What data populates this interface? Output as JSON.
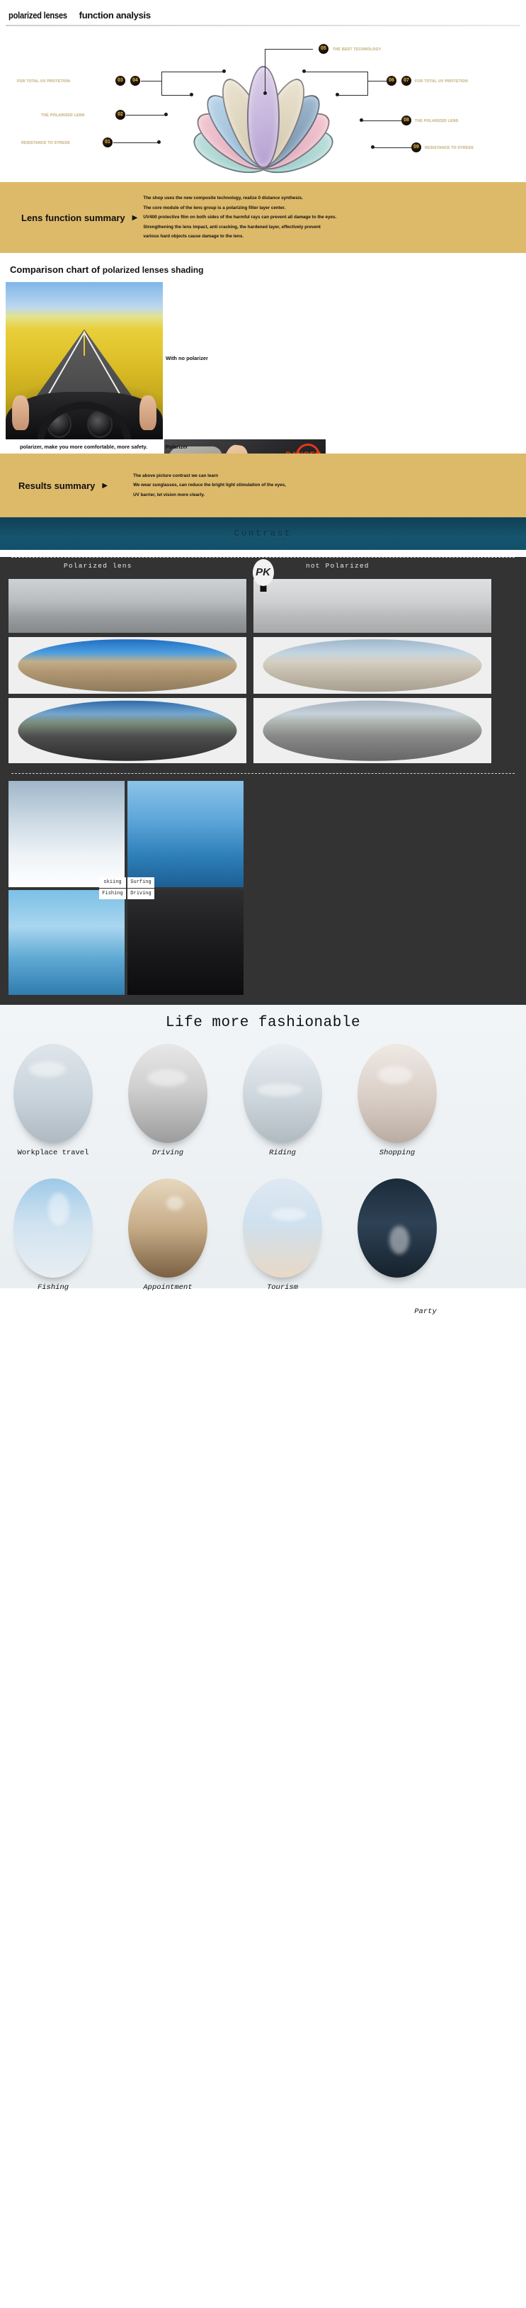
{
  "header": {
    "title_part1": "polarized lenses",
    "title_part2": "function analysis"
  },
  "lotus_diagram": {
    "labels_left": [
      {
        "num": "03",
        "num2": "04",
        "text": "FOR TOTAL UV PROTETION"
      },
      {
        "num": "02",
        "text": "THE POLARIZED LENS"
      },
      {
        "num": "01",
        "text": "RESISTANCE TO STRESS"
      }
    ],
    "labels_right": [
      {
        "num": "06",
        "num2": "07",
        "text": "FOR TOTAL UV PROTETION"
      },
      {
        "num": "08",
        "text": "THE POLARIZED LENS"
      },
      {
        "num": "09",
        "text": "RESISTANCE TO STRESS"
      }
    ],
    "label_top": {
      "num": "05",
      "text": "THE BEST TECHNOLOGY"
    }
  },
  "lens_summary": {
    "title": "Lens function summary",
    "arrow": "▶",
    "lines": [
      "The shop uses the new composite technology, realize 0 distance synthesis.",
      "The core module of the lens group is a polarizing filter layer center.",
      "UV400 protective film on both sides of the harmful rays can prevent all damage to the eyes.",
      "Strengthening the lens impact, anti cracking, the hardened layer, effectively prevent",
      "various hard objects cause damage to the lens."
    ]
  },
  "comparison": {
    "title_part1": "Comparison chart of",
    "title_part2": "polarized lenses shading",
    "caption_main": "polarizer, make you more comfortable, more safety.",
    "caption_no_polarizer": "With no polarizer",
    "caption_polarizer": "Polarizer",
    "danger_label": "DANGER"
  },
  "results_summary": {
    "title": "Results summary",
    "arrow": "▶",
    "lines": [
      "The above picture contrast we can learn",
      "We wear sunglasses, can reduce the bright light stimulation of the eyes,",
      "UV barrier, let vision more clearly."
    ]
  },
  "contrast": {
    "heading": "Contrast",
    "left_label": "Polarized lens",
    "right_label": "not Polarized",
    "pk_label": "PK",
    "activity_tags": [
      "skiing",
      "Surfing",
      "Fishing",
      "Driving"
    ]
  },
  "lifestyle": {
    "title": "Life more fashionable",
    "items": [
      {
        "caption": "Workplace travel",
        "icon": "airplane-icon"
      },
      {
        "caption": "Driving",
        "icon": "car-icon"
      },
      {
        "caption": "Riding",
        "icon": "bicycle-icon"
      },
      {
        "caption": "Shopping",
        "icon": "shopping-icon"
      },
      {
        "caption": "Fishing",
        "icon": "sailboat-icon"
      },
      {
        "caption": "Appointment",
        "icon": "restaurant-icon"
      },
      {
        "caption": "Tourism",
        "icon": "sunglasses-woman-icon"
      },
      {
        "caption": "Party",
        "icon": "party-icon"
      }
    ]
  },
  "colors": {
    "gold_band": "#ddb96a",
    "teal_header": "#13506a",
    "dark_body": "#333334",
    "danger_red": "#e23a1a",
    "badge_gold": "#e8b84b"
  }
}
